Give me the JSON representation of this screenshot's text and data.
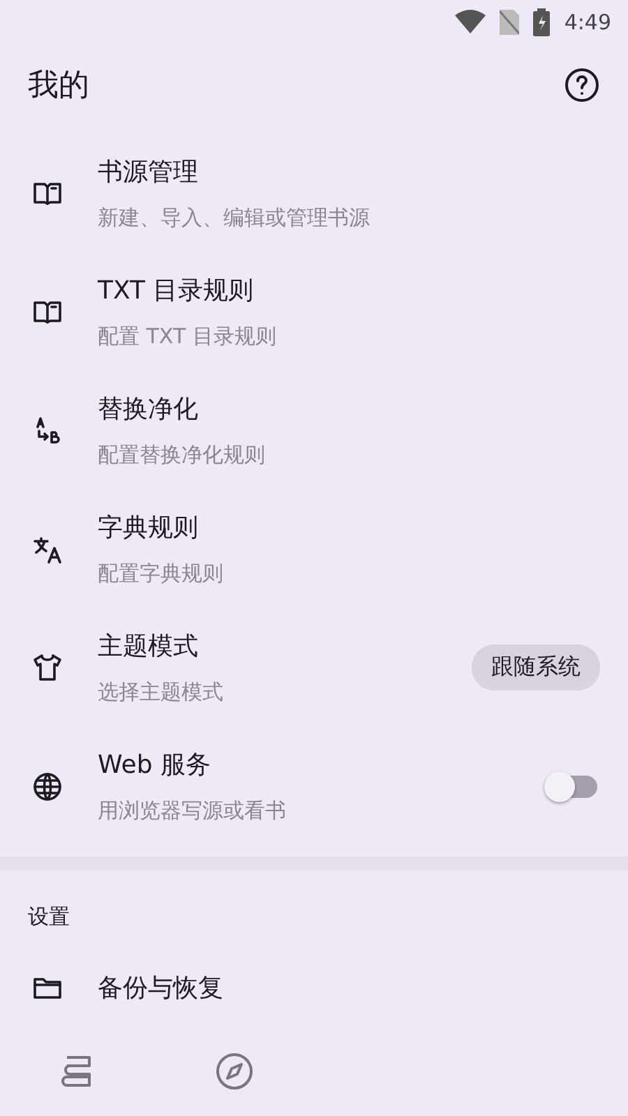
{
  "status_bar": {
    "time": "4:49"
  },
  "header": {
    "title": "我的"
  },
  "items": [
    {
      "kind": "plain",
      "title": "书源管理",
      "subtitle": "新建、导入、编辑或管理书源"
    },
    {
      "kind": "plain",
      "title": "TXT 目录规则",
      "subtitle": "配置 TXT 目录规则"
    },
    {
      "kind": "plain",
      "title": "替换净化",
      "subtitle": "配置替换净化规则"
    },
    {
      "kind": "plain",
      "title": "字典规则",
      "subtitle": "配置字典规则"
    },
    {
      "kind": "chip",
      "title": "主题模式",
      "subtitle": "选择主题模式",
      "value": "跟随系统"
    },
    {
      "kind": "switch",
      "title": "Web 服务",
      "subtitle": "用浏览器写源或看书",
      "on": false
    }
  ],
  "settings": {
    "heading": "设置",
    "items": [
      {
        "title": "备份与恢复"
      }
    ]
  },
  "bottom_nav": [
    {
      "selected": false
    },
    {
      "selected": false
    }
  ]
}
